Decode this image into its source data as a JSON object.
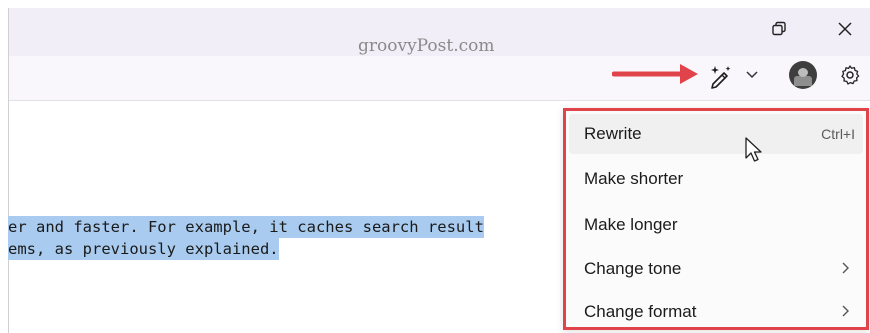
{
  "watermark": "groovyPost.com",
  "window": {
    "restore_icon": "restore-icon",
    "close_icon": "close-icon"
  },
  "toolbar": {
    "rewrite_icon": "copilot-rewrite-icon",
    "dropdown_icon": "chevron-down-icon",
    "avatar": "avatar",
    "settings_icon": "gear-icon"
  },
  "editor": {
    "lines": [
      "er and faster. For example, it caches search result",
      "ems, as previously explained."
    ]
  },
  "menu": {
    "items": [
      {
        "label": "Rewrite",
        "shortcut": "Ctrl+I"
      },
      {
        "label": "Make shorter"
      },
      {
        "label": "Make longer"
      },
      {
        "label": "Change tone"
      },
      {
        "label": "Change format"
      }
    ]
  },
  "colors": {
    "highlight_border": "#e0434a",
    "annotation_arrow": "#e0434a",
    "selection": "#a9cbef"
  }
}
